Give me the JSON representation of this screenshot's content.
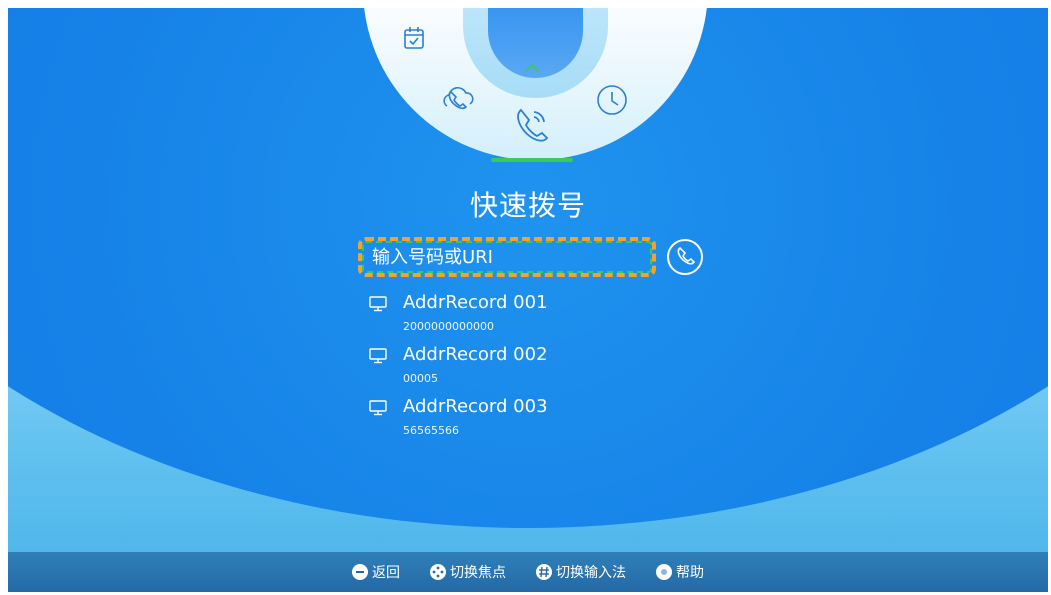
{
  "header": {
    "title": "快速拨号"
  },
  "dial": {
    "placeholder": "输入号码或URI"
  },
  "records": [
    {
      "name": "AddrRecord 001",
      "number": "2000000000000"
    },
    {
      "name": "AddrRecord 002",
      "number": "00005"
    },
    {
      "name": "AddrRecord 003",
      "number": "56565566"
    }
  ],
  "top_menu": {
    "icons": [
      "calendar-icon",
      "cloud-phone-icon",
      "phone-call-icon",
      "clock-icon",
      "chevron-up-icon"
    ]
  },
  "footer": {
    "back": "返回",
    "switch_focus": "切换焦点",
    "switch_input": "切换输入法",
    "help": "帮助"
  },
  "colors": {
    "primary_blue": "#1682e8",
    "focus_orange": "#f5a12a",
    "focus_green": "#3cc85a",
    "footer_blue": "#246aa6"
  }
}
